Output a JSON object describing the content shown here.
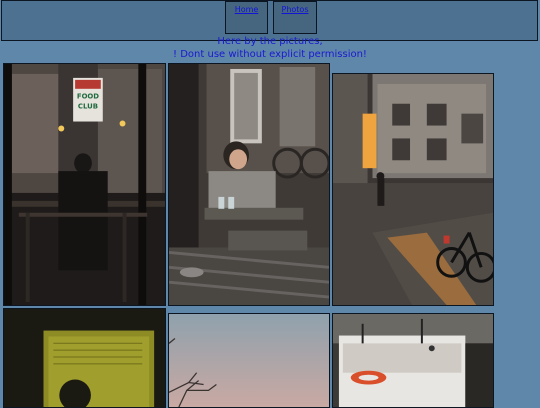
{
  "nav": {
    "items": [
      {
        "label": "Home",
        "icon": "link"
      },
      {
        "label": "Photos",
        "icon": "link"
      }
    ]
  },
  "notices": {
    "line1": "Here by the pictures,",
    "line2": "! Dont use without explicit permission!"
  },
  "colors": {
    "page_background": "#5f87aa",
    "header_background": "#4d7291",
    "link": "#1414d6",
    "notice_text": "#1a1ad0"
  },
  "gallery": {
    "photos": [
      {
        "subject": "Cafe window with Food Club sign",
        "sign_text": [
          "FOOD",
          "CLUB"
        ]
      },
      {
        "subject": "Woman seated at cafe table"
      },
      {
        "subject": "Street at sunset with bicycle"
      },
      {
        "subject": "Yellow lit notice board"
      },
      {
        "subject": "Dusk sky with bare branches"
      },
      {
        "subject": "Boat deck with life ring"
      }
    ]
  }
}
